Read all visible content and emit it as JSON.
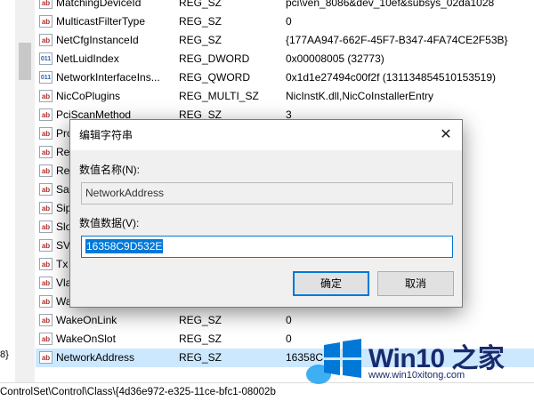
{
  "rows": [
    {
      "name": "MatchingDeviceId",
      "type": "REG_SZ",
      "data": "pci\\ven_8086&dev_10ef&subsys_02da1028",
      "icon": "string-value-icon",
      "glyph": "ab",
      "kind": "str"
    },
    {
      "name": "MulticastFilterType",
      "type": "REG_SZ",
      "data": "0",
      "icon": "string-value-icon",
      "glyph": "ab",
      "kind": "str"
    },
    {
      "name": "NetCfgInstanceId",
      "type": "REG_SZ",
      "data": "{177AA947-662F-45F7-B347-4FA74CE2F53B}",
      "icon": "string-value-icon",
      "glyph": "ab",
      "kind": "str"
    },
    {
      "name": "NetLuidIndex",
      "type": "REG_DWORD",
      "data": "0x00008005 (32773)",
      "icon": "binary-value-icon",
      "glyph": "011",
      "kind": "bin"
    },
    {
      "name": "NetworkInterfaceIns...",
      "type": "REG_QWORD",
      "data": "0x1d1e27494c00f2f (131134854510153519)",
      "icon": "binary-value-icon",
      "glyph": "011",
      "kind": "bin"
    },
    {
      "name": "NicCoPlugins",
      "type": "REG_MULTI_SZ",
      "data": "NicInstK.dll,NicCoInstallerEntry",
      "icon": "string-value-icon",
      "glyph": "ab",
      "kind": "str"
    },
    {
      "name": "PciScanMethod",
      "type": "REG_SZ",
      "data": "3",
      "icon": "string-value-icon",
      "glyph": "ab",
      "kind": "str"
    },
    {
      "name": "Pro",
      "type": "",
      "data": "",
      "icon": "string-value-icon",
      "glyph": "ab",
      "kind": "str"
    },
    {
      "name": "Re",
      "type": "",
      "data": "",
      "icon": "string-value-icon",
      "glyph": "ab",
      "kind": "str"
    },
    {
      "name": "Re",
      "type": "",
      "data": "",
      "icon": "string-value-icon",
      "glyph": "ab",
      "kind": "str"
    },
    {
      "name": "Sa",
      "type": "",
      "data": "",
      "icon": "string-value-icon",
      "glyph": "ab",
      "kind": "str"
    },
    {
      "name": "Sip",
      "type": "",
      "data": "",
      "icon": "string-value-icon",
      "glyph": "ab",
      "kind": "str"
    },
    {
      "name": "Slo",
      "type": "",
      "data": "",
      "icon": "string-value-icon",
      "glyph": "ab",
      "kind": "str"
    },
    {
      "name": "SV",
      "type": "",
      "data": "",
      "icon": "string-value-icon",
      "glyph": "ab",
      "kind": "str"
    },
    {
      "name": "Tx",
      "type": "",
      "data": "",
      "icon": "string-value-icon",
      "glyph": "ab",
      "kind": "str"
    },
    {
      "name": "Vla",
      "type": "",
      "data": "",
      "icon": "string-value-icon",
      "glyph": "ab",
      "kind": "str"
    },
    {
      "name": "Wa",
      "type": "",
      "data": "",
      "icon": "string-value-icon",
      "glyph": "ab",
      "kind": "str"
    },
    {
      "name": "WakeOnLink",
      "type": "REG_SZ",
      "data": "0",
      "icon": "string-value-icon",
      "glyph": "ab",
      "kind": "str"
    },
    {
      "name": "WakeOnSlot",
      "type": "REG_SZ",
      "data": "0",
      "icon": "string-value-icon",
      "glyph": "ab",
      "kind": "str"
    },
    {
      "name": "NetworkAddress",
      "type": "REG_SZ",
      "data": "16358C",
      "icon": "string-value-icon",
      "glyph": "ab",
      "kind": "str",
      "selected": true
    }
  ],
  "tree": {
    "partial_text": "8}"
  },
  "statusbar": {
    "path": "ControlSet\\Control\\Class\\{4d36e972-e325-11ce-bfc1-08002b"
  },
  "dialog": {
    "title": "编辑字符串",
    "name_label": "数值名称(N):",
    "name_value": "NetworkAddress",
    "data_label": "数值数据(V):",
    "data_value": "16358C9D532E",
    "ok_label": "确定",
    "cancel_label": "取消",
    "close_glyph": "✕",
    "accent": "#0078d7"
  },
  "watermark": {
    "brand": "Win10 之家",
    "url": "www.win10xitong.com",
    "colors": [
      "#1a2a6c",
      "#0078d7"
    ]
  }
}
